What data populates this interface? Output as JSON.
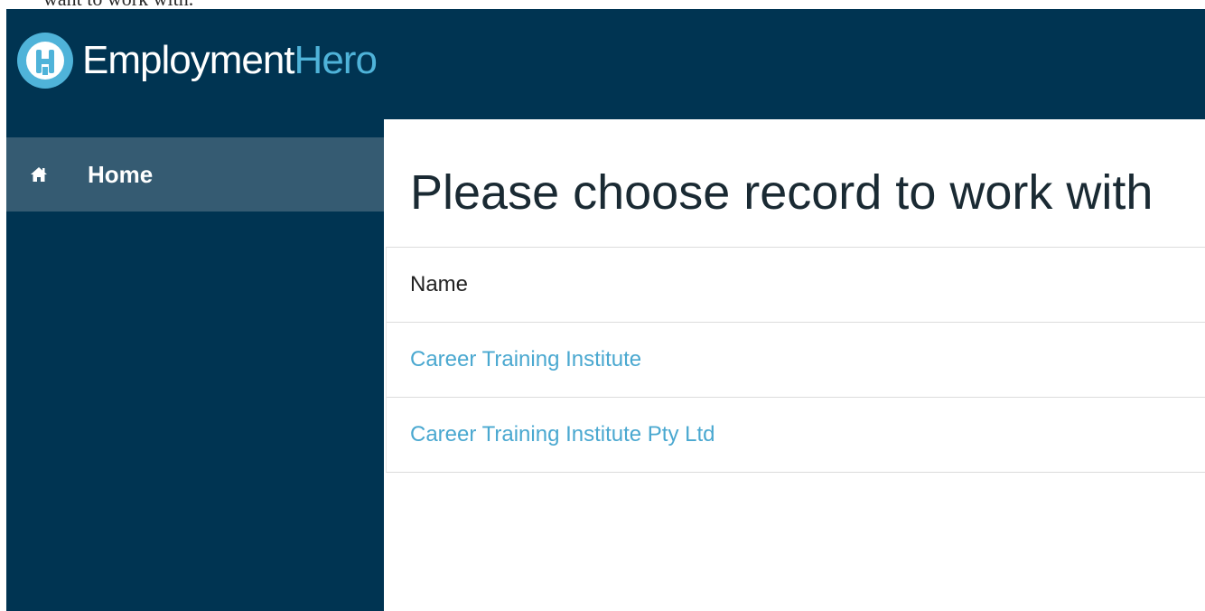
{
  "caption": "want to work with.",
  "brand": {
    "name_primary": "Employment",
    "name_accent": "Hero",
    "accent_color": "#4fb3d9",
    "background_color": "#003452"
  },
  "sidebar": {
    "items": [
      {
        "label": "Home",
        "icon": "home-icon",
        "active": true
      }
    ]
  },
  "main": {
    "title": "Please choose record to work with",
    "table": {
      "header": "Name",
      "rows": [
        {
          "name": "Career Training Institute"
        },
        {
          "name": "Career Training Institute Pty Ltd"
        }
      ]
    }
  }
}
